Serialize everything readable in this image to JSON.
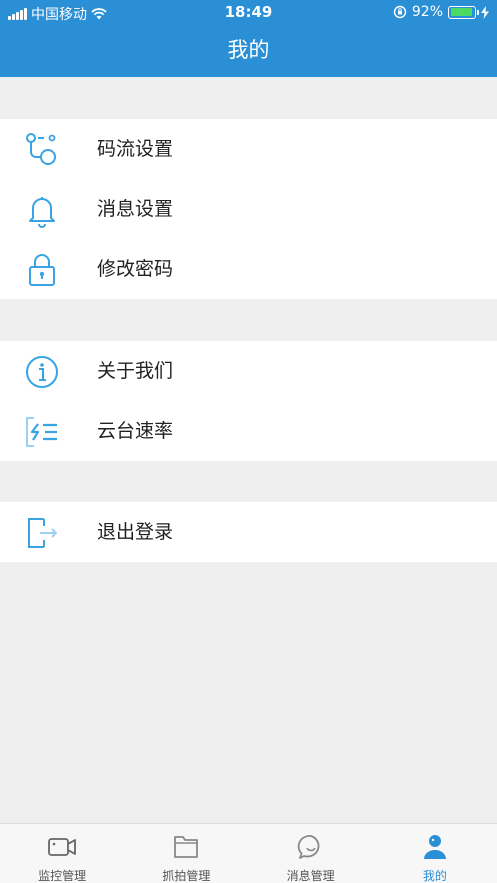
{
  "status_bar": {
    "carrier": "中国移动",
    "time": "18:49",
    "battery_percent": "92%",
    "battery_level": 0.92
  },
  "header": {
    "title": "我的"
  },
  "groups": [
    {
      "items": [
        {
          "label": "码流设置",
          "icon": "stream-settings-icon"
        },
        {
          "label": "消息设置",
          "icon": "bell-icon"
        },
        {
          "label": "修改密码",
          "icon": "lock-icon"
        }
      ]
    },
    {
      "items": [
        {
          "label": "关于我们",
          "icon": "info-icon"
        },
        {
          "label": "云台速率",
          "icon": "ptz-speed-icon"
        }
      ]
    },
    {
      "items": [
        {
          "label": "退出登录",
          "icon": "logout-icon"
        }
      ]
    }
  ],
  "tabbar": {
    "tabs": [
      {
        "label": "监控管理",
        "icon": "camera-icon"
      },
      {
        "label": "抓拍管理",
        "icon": "folder-icon"
      },
      {
        "label": "消息管理",
        "icon": "chat-icon"
      },
      {
        "label": "我的",
        "icon": "user-icon",
        "active": true
      }
    ]
  },
  "colors": {
    "accent": "#2b8fd6",
    "icon_blue": "#3aa3e3",
    "background": "#efefef"
  }
}
